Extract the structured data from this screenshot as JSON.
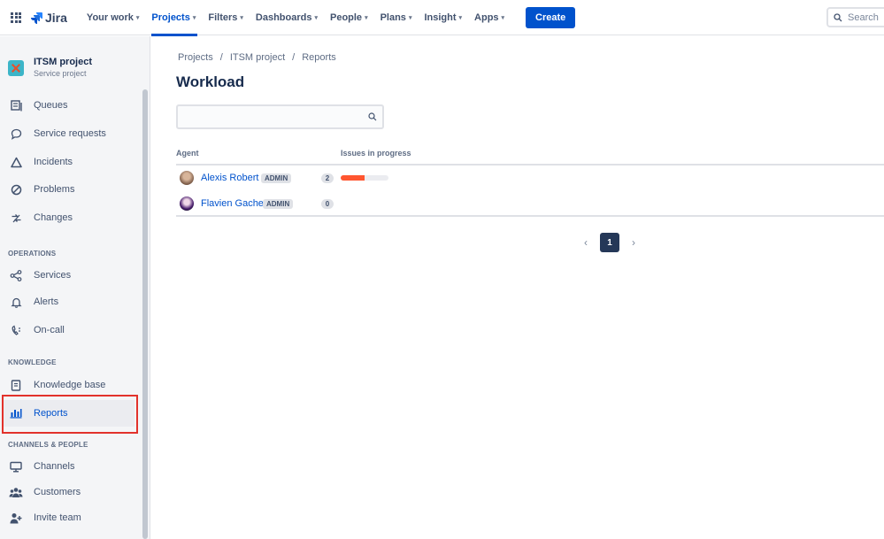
{
  "topnav": {
    "logo": "Jira",
    "items": [
      {
        "label": "Your work"
      },
      {
        "label": "Projects",
        "active": true
      },
      {
        "label": "Filters"
      },
      {
        "label": "Dashboards"
      },
      {
        "label": "People"
      },
      {
        "label": "Plans"
      },
      {
        "label": "Insight"
      },
      {
        "label": "Apps"
      }
    ],
    "create_label": "Create",
    "search_placeholder": "Search"
  },
  "sidebar": {
    "project_name": "ITSM project",
    "project_type": "Service project",
    "items": [
      {
        "label": "Queues",
        "icon": "queues-icon"
      },
      {
        "label": "Service requests",
        "icon": "speech-bubble-icon"
      },
      {
        "label": "Incidents",
        "icon": "warning-triangle-icon"
      },
      {
        "label": "Problems",
        "icon": "no-entry-icon"
      },
      {
        "label": "Changes",
        "icon": "changes-icon"
      }
    ],
    "sections": {
      "operations": "OPERATIONS",
      "knowledge": "KNOWLEDGE",
      "channels": "CHANNELS & PEOPLE"
    },
    "operations_items": [
      {
        "label": "Services",
        "icon": "services-icon"
      },
      {
        "label": "Alerts",
        "icon": "bell-icon"
      },
      {
        "label": "On-call",
        "icon": "phone-icon"
      }
    ],
    "knowledge_items": [
      {
        "label": "Knowledge base",
        "icon": "book-icon"
      },
      {
        "label": "Reports",
        "icon": "bar-chart-icon",
        "selected": true
      }
    ],
    "channels_items": [
      {
        "label": "Channels",
        "icon": "monitor-icon"
      },
      {
        "label": "Customers",
        "icon": "people-icon"
      },
      {
        "label": "Invite team",
        "icon": "add-person-icon"
      }
    ]
  },
  "main": {
    "breadcrumb": [
      "Projects",
      "/",
      "ITSM project",
      "/",
      "Reports"
    ],
    "title": "Workload",
    "filter_placeholder": "",
    "columns": {
      "agent": "Agent",
      "issues": "Issues in progress"
    },
    "rows": [
      {
        "name": "Alexis Robert",
        "badge": "ADMIN",
        "count": "2",
        "progress": 0.5
      },
      {
        "name": "Flavien Gache",
        "badge": "ADMIN",
        "count": "0",
        "progress": 0
      }
    ],
    "pagination": {
      "current": "1"
    }
  },
  "colors": {
    "brand": "#0052cc",
    "progress": "#ff5630",
    "highlight": "#e2322b"
  }
}
